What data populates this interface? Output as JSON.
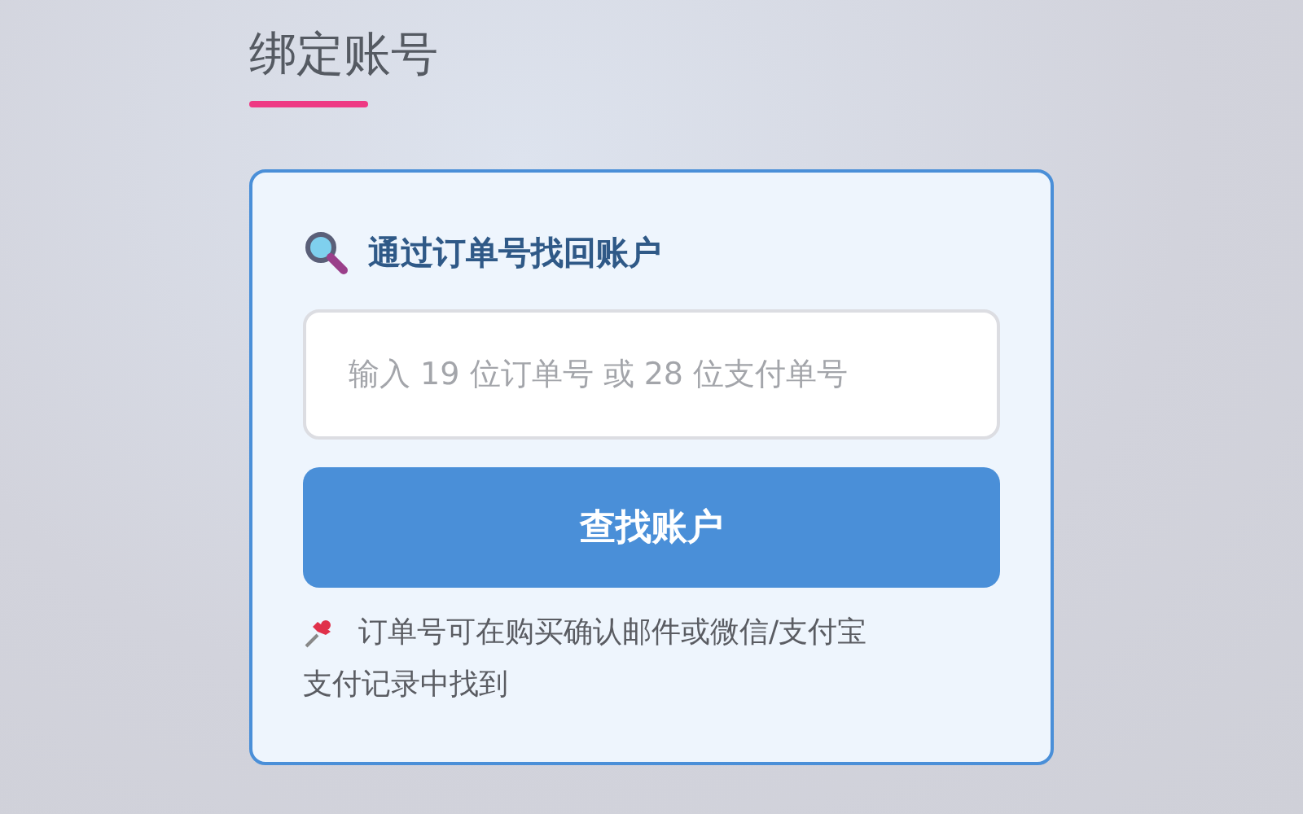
{
  "page_title": "绑定账号",
  "card": {
    "heading": "通过订单号找回账户",
    "order_field": {
      "placeholder": "输入 19 位订单号 或 28 位支付单号"
    },
    "submit_button": "查找账户",
    "note_lines": [
      "订单号可在购买确认邮件或微信/支付宝",
      "支付记录中找到"
    ]
  }
}
